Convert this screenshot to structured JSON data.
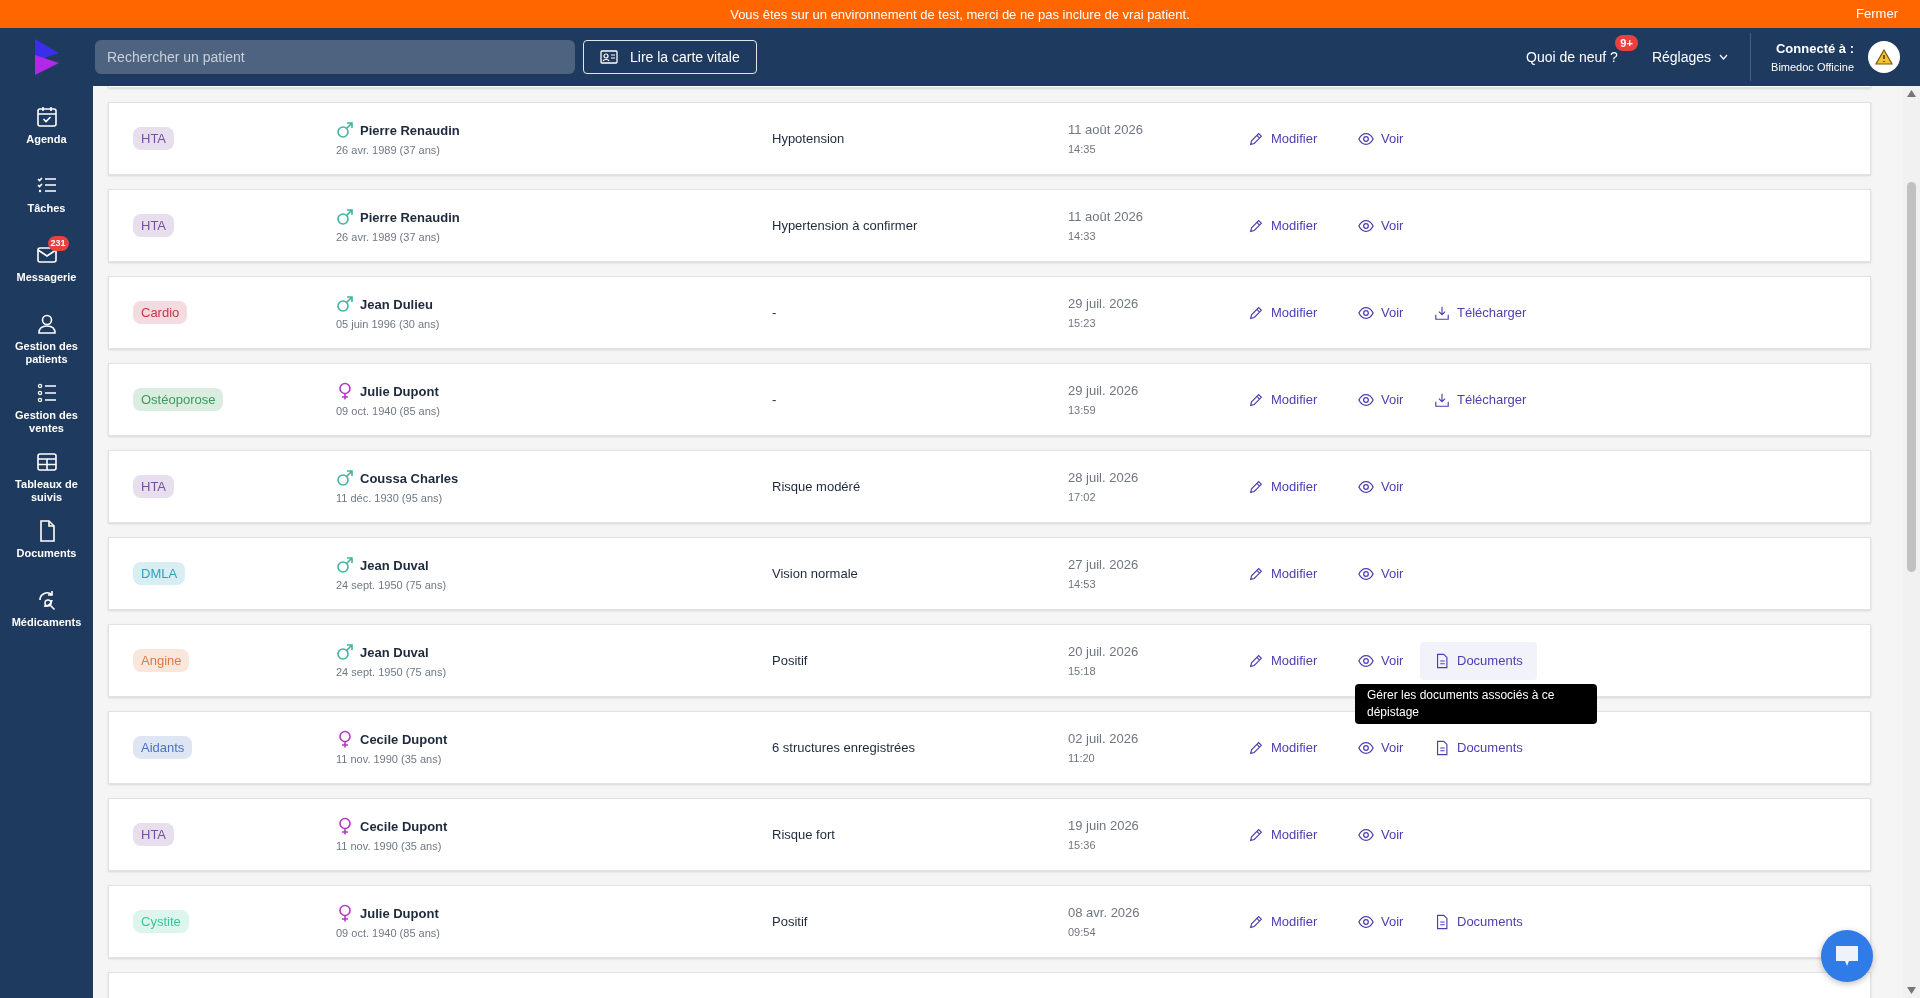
{
  "banner": {
    "message": "Vous êtes sur un environnement de test, merci de ne pas inclure de vrai patient.",
    "close": "Fermer"
  },
  "header": {
    "search": {
      "placeholder": "Rechercher un patient"
    },
    "card_button": "Lire la carte vitale",
    "news": {
      "label": "Quoi de neuf ?",
      "badge": "9+"
    },
    "settings": "Réglages",
    "account": {
      "label": "Connecté à :",
      "name": "Bimedoc Officine"
    }
  },
  "sidebar": {
    "items": [
      {
        "label": "Agenda",
        "kind": "calendar"
      },
      {
        "label": "Tâches",
        "kind": "tasks"
      },
      {
        "label": "Messagerie",
        "kind": "mail",
        "badge": "231"
      },
      {
        "label": "Gestion des patients",
        "kind": "user"
      },
      {
        "label": "Gestion des ventes",
        "kind": "list"
      },
      {
        "label": "Tableaux de suivis",
        "kind": "table"
      },
      {
        "label": "Documents",
        "kind": "file"
      },
      {
        "label": "Médicaments",
        "kind": "search"
      }
    ]
  },
  "rows": [
    {
      "tag": "HTA",
      "color": "#7b4fa0",
      "kind": "male",
      "name": "Pierre Renaudin",
      "birth": "26 avr. 1989 (37 ans)",
      "result": "Hypotension",
      "date": "11 août 2026",
      "time": "14:35",
      "actions": [
        {
          "kind": "edit",
          "label": "Modifier",
          "hover": false
        },
        {
          "kind": "view",
          "label": "Voir",
          "hover": false
        }
      ]
    },
    {
      "tag": "HTA",
      "color": "#7b4fa0",
      "kind": "male",
      "name": "Pierre Renaudin",
      "birth": "26 avr. 1989 (37 ans)",
      "result": "Hypertension à confirmer",
      "date": "11 août 2026",
      "time": "14:33",
      "actions": [
        {
          "kind": "edit",
          "label": "Modifier",
          "hover": false
        },
        {
          "kind": "view",
          "label": "Voir",
          "hover": false
        }
      ]
    },
    {
      "tag": "Cardio",
      "color": "#c0394b",
      "kind": "male",
      "name": "Jean Dulieu",
      "birth": "05 juin 1996 (30 ans)",
      "result": "-",
      "date": "29 juil. 2026",
      "time": "15:23",
      "actions": [
        {
          "kind": "edit",
          "label": "Modifier",
          "hover": false
        },
        {
          "kind": "view",
          "label": "Voir",
          "hover": false
        },
        {
          "kind": "download",
          "label": "Télécharger",
          "hover": false
        }
      ]
    },
    {
      "tag": "Ostéoporose",
      "color": "#3a9a5a",
      "kind": "female",
      "name": "Julie Dupont",
      "birth": "09 oct. 1940 (85 ans)",
      "result": "-",
      "date": "29 juil. 2026",
      "time": "13:59",
      "actions": [
        {
          "kind": "edit",
          "label": "Modifier",
          "hover": false
        },
        {
          "kind": "view",
          "label": "Voir",
          "hover": false
        },
        {
          "kind": "download",
          "label": "Télécharger",
          "hover": false
        }
      ]
    },
    {
      "tag": "HTA",
      "color": "#7b4fa0",
      "kind": "male",
      "name": "Coussa Charles",
      "birth": "11 déc. 1930 (95 ans)",
      "result": "Risque modéré",
      "date": "28 juil. 2026",
      "time": "17:02",
      "actions": [
        {
          "kind": "edit",
          "label": "Modifier",
          "hover": false
        },
        {
          "kind": "view",
          "label": "Voir",
          "hover": false
        }
      ]
    },
    {
      "tag": "DMLA",
      "color": "#2ba3b8",
      "kind": "male",
      "name": "Jean Duval",
      "birth": "24 sept. 1950 (75 ans)",
      "result": "Vision normale",
      "date": "27 juil. 2026",
      "time": "14:53",
      "actions": [
        {
          "kind": "edit",
          "label": "Modifier",
          "hover": false
        },
        {
          "kind": "view",
          "label": "Voir",
          "hover": false
        }
      ]
    },
    {
      "tag": "Angine",
      "color": "#e27a3a",
      "kind": "male",
      "name": "Jean Duval",
      "birth": "24 sept. 1950 (75 ans)",
      "result": "Positif",
      "date": "20 juil. 2026",
      "time": "15:18",
      "actions": [
        {
          "kind": "edit",
          "label": "Modifier",
          "hover": false
        },
        {
          "kind": "view",
          "label": "Voir",
          "hover": false
        },
        {
          "kind": "documents",
          "label": "Documents",
          "hover": true,
          "tooltip": "Gérer les documents associés à ce dépistage"
        }
      ]
    },
    {
      "tag": "Aidants",
      "color": "#4a72c4",
      "kind": "female",
      "name": "Cecile Dupont",
      "birth": "11 nov. 1990 (35 ans)",
      "result": "6 structures enregistrées",
      "date": "02 juil. 2026",
      "time": "11:20",
      "actions": [
        {
          "kind": "edit",
          "label": "Modifier",
          "hover": false
        },
        {
          "kind": "view",
          "label": "Voir",
          "hover": false
        },
        {
          "kind": "documents",
          "label": "Documents",
          "hover": false
        }
      ]
    },
    {
      "tag": "HTA",
      "color": "#7b4fa0",
      "kind": "female",
      "name": "Cecile Dupont",
      "birth": "11 nov. 1990 (35 ans)",
      "result": "Risque fort",
      "date": "19 juin 2026",
      "time": "15:36",
      "actions": [
        {
          "kind": "edit",
          "label": "Modifier",
          "hover": false
        },
        {
          "kind": "view",
          "label": "Voir",
          "hover": false
        }
      ]
    },
    {
      "tag": "Cystite",
      "color": "#3cc59a",
      "kind": "female",
      "name": "Julie Dupont",
      "birth": "09 oct. 1940 (85 ans)",
      "result": "Positif",
      "date": "08 avr. 2026",
      "time": "09:54",
      "actions": [
        {
          "kind": "edit",
          "label": "Modifier",
          "hover": false
        },
        {
          "kind": "view",
          "label": "Voir",
          "hover": false
        },
        {
          "kind": "documents",
          "label": "Documents",
          "hover": false
        }
      ]
    }
  ]
}
